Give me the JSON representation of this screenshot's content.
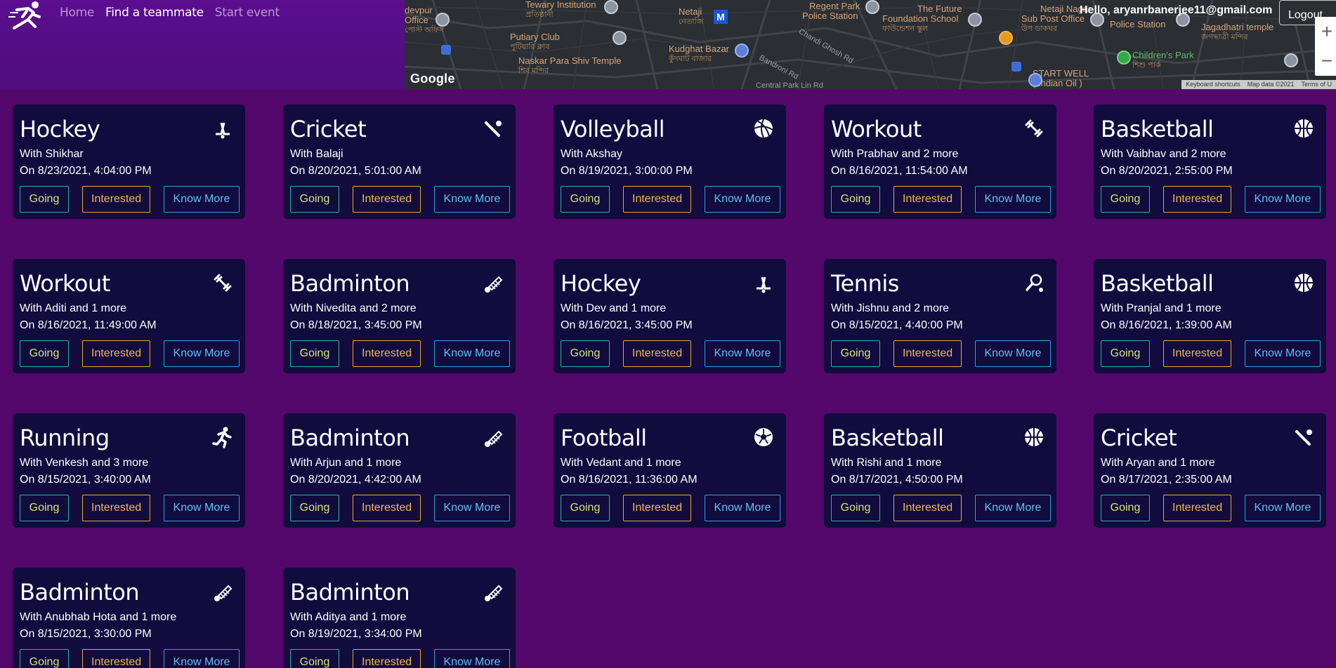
{
  "nav": {
    "items": [
      {
        "label": "Home",
        "active": false
      },
      {
        "label": "Find a teammate",
        "active": true
      },
      {
        "label": "Start event",
        "active": false
      }
    ]
  },
  "user": {
    "greeting": "Hello, aryanrbanerjee11@gmail.com",
    "logout_label": "Logout"
  },
  "map": {
    "brand": "Google",
    "zoom_in": "+",
    "zoom_out": "−",
    "metro_label": "M",
    "attribution": [
      "Keyboard shortcuts",
      "Map data ©2021",
      "Terms of U"
    ],
    "labels": [
      {
        "text": "devpur",
        "sub": ""
      },
      {
        "text": "Office",
        "sub": "পোস্ট অফিস"
      },
      {
        "text": "Tewary Institution",
        "sub": "প্রতিষ্ঠানী"
      },
      {
        "text": "Putiary Club",
        "sub": "পুটিয়ারি ক্লাব"
      },
      {
        "text": "Naskar Para Shiv Temple",
        "sub": "শিব মন্দির"
      },
      {
        "text": "Netaji",
        "sub": "নেতাজি"
      },
      {
        "text": "Kudghat Bazar",
        "sub": "কুঁদঘাট বাজার"
      },
      {
        "text": "Regent Park",
        "sub": ""
      },
      {
        "text": "Police Station",
        "sub": ""
      },
      {
        "text": "The Future",
        "sub": ""
      },
      {
        "text": "Foundation School",
        "sub": "ফাউন্ডেশন স্কুল"
      },
      {
        "text": "Netaji Nagar",
        "sub": ""
      },
      {
        "text": "Sub Post Office",
        "sub": "উপ ডাকঘর"
      },
      {
        "text": "Police Station",
        "sub": ""
      },
      {
        "text": "Jagadhatri temple",
        "sub": "জগদ্ধাত্রী মন্দির"
      },
      {
        "text": "Children's Park",
        "sub": "শিশু পার্ক"
      },
      {
        "text": "START WELL",
        "sub": ""
      },
      {
        "text": "( Indian Oil )",
        "sub": ""
      }
    ],
    "roads": [
      "Bandroni Rd",
      "Chandi Ghosh Rd",
      "Central Park Lin Rd"
    ]
  },
  "card_buttons": {
    "going": "Going",
    "interested": "Interested",
    "know_more": "Know More"
  },
  "colors": {
    "background": "#54086b",
    "card": "#120b3d",
    "going": "#27b3a4",
    "interested": "#e8a92e",
    "know_more": "#2f9fe0"
  },
  "events": [
    {
      "sport": "Hockey",
      "with": "With Shikhar",
      "date": "On 8/23/2021, 4:04:00 PM",
      "icon": "hockey-icon"
    },
    {
      "sport": "Cricket",
      "with": "With Balaji",
      "date": "On 8/20/2021, 5:01:00 AM",
      "icon": "cricket-icon"
    },
    {
      "sport": "Volleyball",
      "with": "With Akshay",
      "date": "On 8/19/2021, 3:00:00 PM",
      "icon": "volleyball-icon"
    },
    {
      "sport": "Workout",
      "with": "With Prabhav and 2 more",
      "date": "On 8/16/2021, 11:54:00 AM",
      "icon": "dumbbell-icon"
    },
    {
      "sport": "Basketball",
      "with": "With Vaibhav and 2 more",
      "date": "On 8/20/2021, 2:55:00 PM",
      "icon": "basketball-icon"
    },
    {
      "sport": "Workout",
      "with": "With Aditi and 1 more",
      "date": "On 8/16/2021, 11:49:00 AM",
      "icon": "dumbbell-icon"
    },
    {
      "sport": "Badminton",
      "with": "With Nivedita and 2 more",
      "date": "On 8/18/2021, 3:45:00 PM",
      "icon": "shuttlecock-icon"
    },
    {
      "sport": "Hockey",
      "with": "With Dev and 1 more",
      "date": "On 8/16/2021, 3:45:00 PM",
      "icon": "hockey-icon"
    },
    {
      "sport": "Tennis",
      "with": "With Jishnu and 2 more",
      "date": "On 8/15/2021, 4:40:00 PM",
      "icon": "tennis-icon"
    },
    {
      "sport": "Basketball",
      "with": "With Pranjal and 1 more",
      "date": "On 8/16/2021, 1:39:00 AM",
      "icon": "basketball-icon"
    },
    {
      "sport": "Running",
      "with": "With Venkesh and 3 more",
      "date": "On 8/15/2021, 3:40:00 AM",
      "icon": "running-icon"
    },
    {
      "sport": "Badminton",
      "with": "With Arjun and 1 more",
      "date": "On 8/20/2021, 4:42:00 AM",
      "icon": "shuttlecock-icon"
    },
    {
      "sport": "Football",
      "with": "With Vedant and 1 more",
      "date": "On 8/16/2021, 11:36:00 AM",
      "icon": "football-icon"
    },
    {
      "sport": "Basketball",
      "with": "With Rishi and 1 more",
      "date": "On 8/17/2021, 4:50:00 PM",
      "icon": "basketball-icon"
    },
    {
      "sport": "Cricket",
      "with": "With Aryan and 1 more",
      "date": "On 8/17/2021, 2:35:00 AM",
      "icon": "cricket-icon"
    },
    {
      "sport": "Badminton",
      "with": "With Anubhab Hota and 1 more",
      "date": "On 8/15/2021, 3:30:00 PM",
      "icon": "shuttlecock-icon"
    },
    {
      "sport": "Badminton",
      "with": "With Aditya and 1 more",
      "date": "On 8/19/2021, 3:34:00 PM",
      "icon": "shuttlecock-icon"
    }
  ]
}
